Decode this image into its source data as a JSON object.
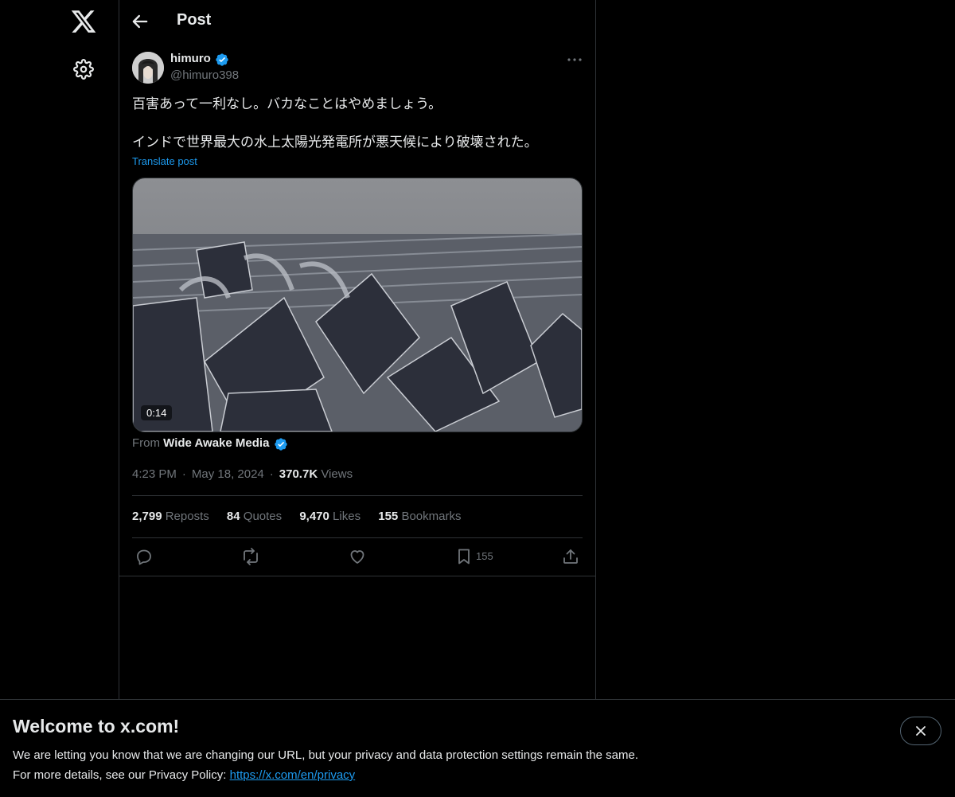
{
  "nav": {
    "logo_icon": "x-logo-icon",
    "settings_icon": "gear-icon"
  },
  "header": {
    "title": "Post",
    "back_icon": "arrow-left-icon"
  },
  "post": {
    "author": {
      "name": "himuro",
      "handle": "@himuro398",
      "verified": true
    },
    "text_lines": [
      "百害あって一利なし。バカなことはやめましょう。",
      "インドで世界最大の水上太陽光発電所が悪天候により破壊された。"
    ],
    "translate_label": "Translate post",
    "video_duration": "0:14",
    "source_prefix": "From",
    "source_name": "Wide Awake Media",
    "time": "4:23 PM",
    "date": "May 18, 2024",
    "views_count": "370.7K",
    "views_label": "Views",
    "stats": {
      "reposts_count": "2,799",
      "reposts_label": "Reposts",
      "quotes_count": "84",
      "quotes_label": "Quotes",
      "likes_count": "9,470",
      "likes_label": "Likes",
      "bookmarks_count": "155",
      "bookmarks_label": "Bookmarks"
    },
    "actions": {
      "bookmark_count": "155"
    }
  },
  "banner": {
    "title": "Welcome to x.com!",
    "line1": "We are letting you know that we are changing our URL, but your privacy and data protection settings remain the same.",
    "line2_prefix": "For more details, see our Privacy Policy:",
    "link": "https://x.com/en/privacy"
  },
  "colors": {
    "background": "#000000",
    "text": "#e7e9ea",
    "muted": "#71767b",
    "accent": "#1d9bf0",
    "border": "#2f3336"
  }
}
